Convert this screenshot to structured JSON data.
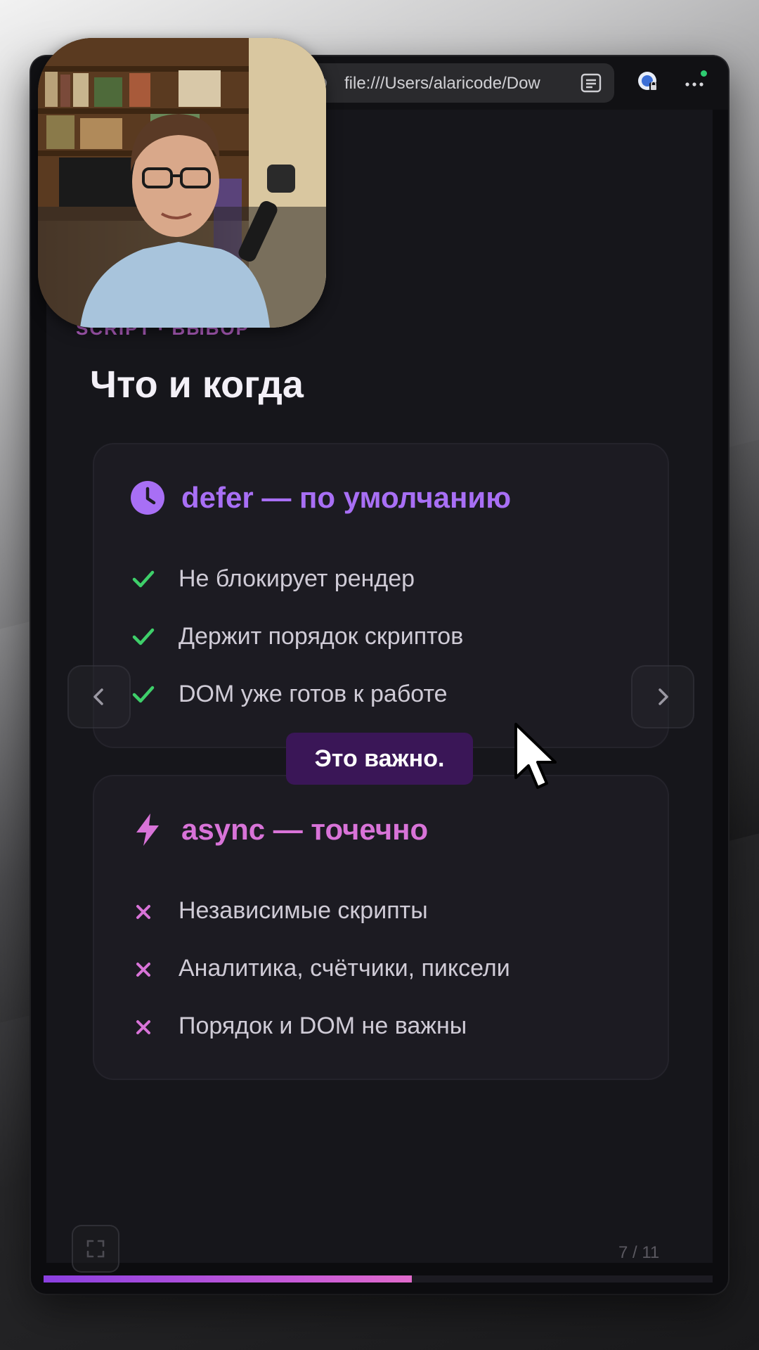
{
  "browser": {
    "url": "file:///Users/alaricode/Dow"
  },
  "slide": {
    "eyebrow": "SCRIPT · ВЫБОР",
    "title": "Что и когда",
    "cards": [
      {
        "title": "defer — по умолчанию",
        "icon": "clock-icon",
        "accent": "#a86ff5",
        "items": [
          {
            "mark": "check",
            "text": "Не блокирует рендер"
          },
          {
            "mark": "check",
            "text": "Держит порядок скриптов"
          },
          {
            "mark": "check",
            "text": "DOM уже готов к работе"
          }
        ]
      },
      {
        "title": "async — точечно",
        "icon": "lightning-icon",
        "accent": "#d873d8",
        "items": [
          {
            "mark": "cross",
            "text": "Независимые скрипты"
          },
          {
            "mark": "cross",
            "text": "Аналитика, счётчики, пиксели"
          },
          {
            "mark": "cross",
            "text": "Порядок и DOM не важны"
          }
        ]
      }
    ]
  },
  "caption": "Это важно.",
  "pager": {
    "counter": "7 / 11",
    "progress_percent": 55
  },
  "colors": {
    "check": "#3ecf6a",
    "cross": "#d873d8",
    "caption_bg": "#3a1657"
  }
}
